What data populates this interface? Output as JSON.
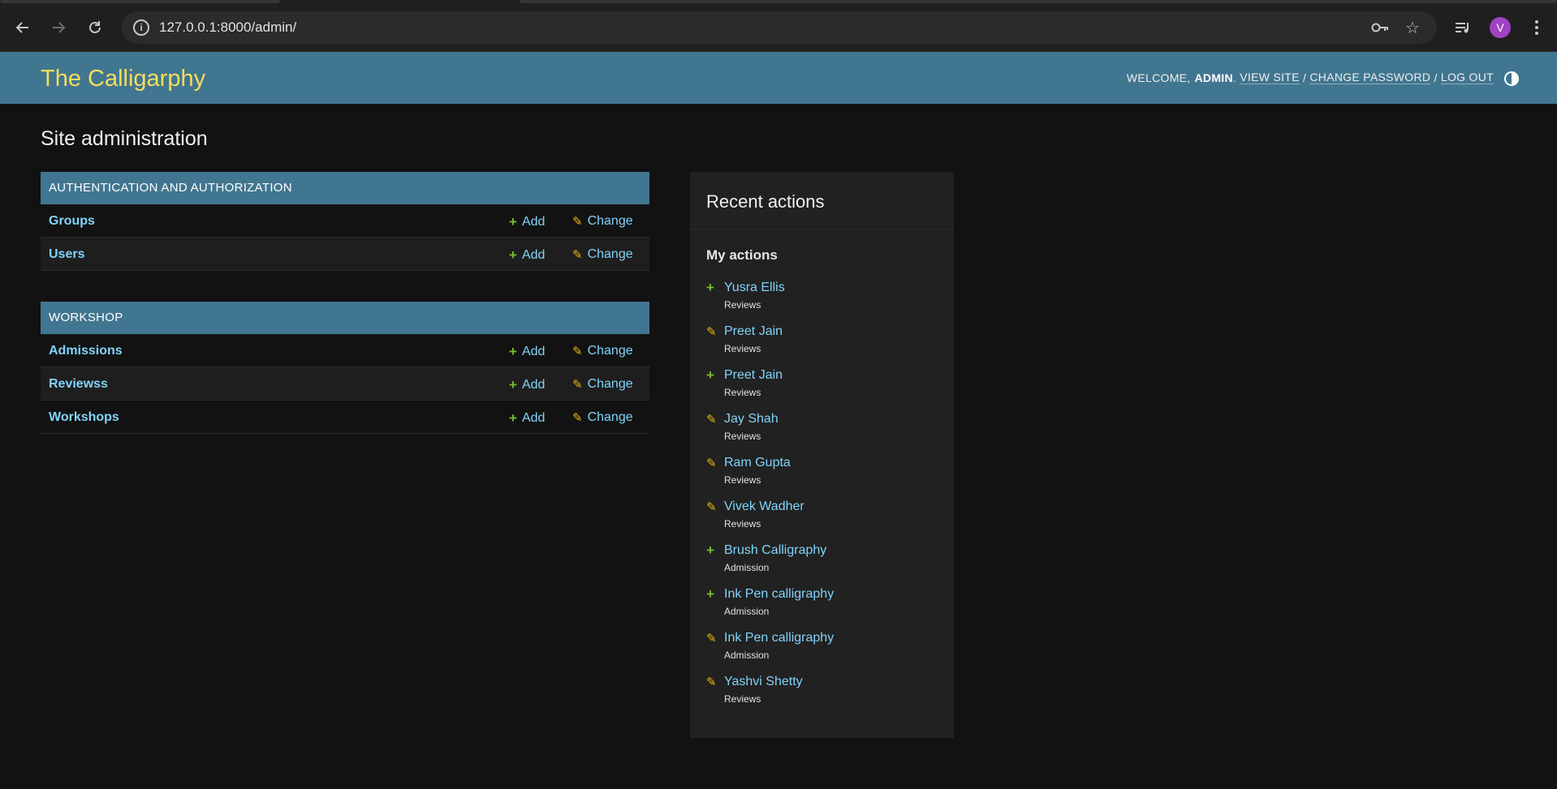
{
  "browser": {
    "url": "127.0.0.1:8000/admin/",
    "avatar_letter": "V"
  },
  "header": {
    "site_name": "The Calligarphy",
    "welcome": "WELCOME,",
    "username": "ADMIN",
    "view_site": "VIEW SITE",
    "change_password": "CHANGE PASSWORD",
    "log_out": "LOG OUT",
    "separator": "/"
  },
  "page_title": "Site administration",
  "apps": [
    {
      "caption": "AUTHENTICATION AND AUTHORIZATION",
      "models": [
        {
          "name": "Groups",
          "add": "Add",
          "change": "Change"
        },
        {
          "name": "Users",
          "add": "Add",
          "change": "Change"
        }
      ]
    },
    {
      "caption": "WORKSHOP",
      "models": [
        {
          "name": "Admissions",
          "add": "Add",
          "change": "Change"
        },
        {
          "name": "Reviewss",
          "add": "Add",
          "change": "Change"
        },
        {
          "name": "Workshops",
          "add": "Add",
          "change": "Change"
        }
      ]
    }
  ],
  "recent_actions": {
    "title": "Recent actions",
    "subtitle": "My actions",
    "items": [
      {
        "kind": "add",
        "name": "Yusra Ellis",
        "type": "Reviews"
      },
      {
        "kind": "change",
        "name": "Preet Jain",
        "type": "Reviews"
      },
      {
        "kind": "add",
        "name": "Preet Jain",
        "type": "Reviews"
      },
      {
        "kind": "change",
        "name": "Jay Shah",
        "type": "Reviews"
      },
      {
        "kind": "change",
        "name": "Ram Gupta",
        "type": "Reviews"
      },
      {
        "kind": "change",
        "name": "Vivek Wadher",
        "type": "Reviews"
      },
      {
        "kind": "add",
        "name": "Brush Calligraphy",
        "type": "Admission"
      },
      {
        "kind": "add",
        "name": "Ink Pen calligraphy",
        "type": "Admission"
      },
      {
        "kind": "change",
        "name": "Ink Pen calligraphy",
        "type": "Admission"
      },
      {
        "kind": "change",
        "name": "Yashvi Shetty",
        "type": "Reviews"
      }
    ]
  },
  "colors": {
    "header_bg": "#417690",
    "branding": "#f5dd5d",
    "link": "#81d4fa",
    "add_icon": "#70bf2b",
    "change_icon": "#efb80b",
    "page_bg": "#121212"
  },
  "icons": {
    "back": "back-arrow-icon",
    "forward": "forward-arrow-icon",
    "reload": "reload-icon",
    "info": "site-info-icon",
    "password": "key-icon",
    "bookmark": "star-icon",
    "media": "media-queue-icon",
    "menu": "kebab-menu-icon",
    "theme": "theme-toggle-icon",
    "add": "plus-icon",
    "change": "pencil-icon"
  }
}
